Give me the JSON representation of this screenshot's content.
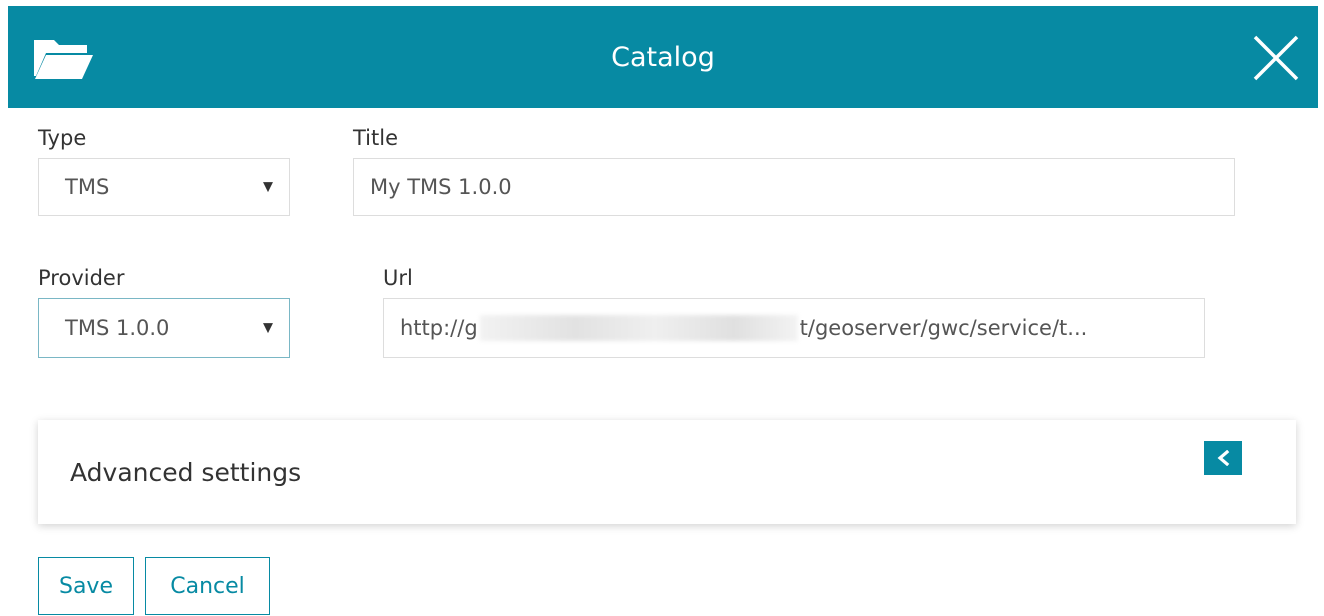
{
  "header": {
    "title": "Catalog",
    "left_icon": "folder-open-icon",
    "right_icon": "close-icon",
    "color": "#078aa3"
  },
  "form": {
    "type": {
      "label": "Type",
      "value": "TMS"
    },
    "title": {
      "label": "Title",
      "value": "My TMS 1.0.0"
    },
    "provider": {
      "label": "Provider",
      "value": "TMS 1.0.0"
    },
    "url": {
      "label": "Url",
      "prefix": "http://g",
      "suffix": "t/geoserver/gwc/service/t..."
    }
  },
  "advanced": {
    "label": "Advanced settings",
    "toggle_icon": "chevron-left-icon"
  },
  "actions": {
    "save": "Save",
    "cancel": "Cancel"
  }
}
